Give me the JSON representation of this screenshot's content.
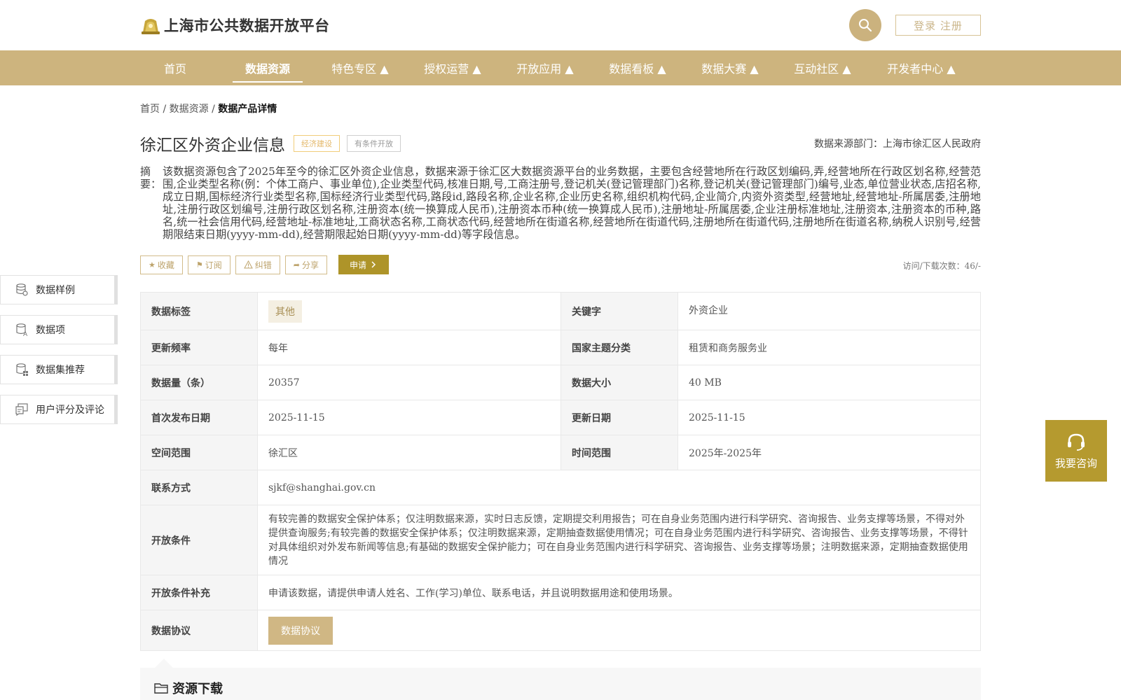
{
  "header": {
    "site_title": "上海市公共数据开放平台",
    "login_label": "登录 注册"
  },
  "nav": [
    {
      "label": "首页"
    },
    {
      "label": "数据资源"
    },
    {
      "label": "特色专区 ▲"
    },
    {
      "label": "授权运营 ▲"
    },
    {
      "label": "开放应用 ▲"
    },
    {
      "label": "数据看板 ▲"
    },
    {
      "label": "数据大赛 ▲"
    },
    {
      "label": "互动社区 ▲"
    },
    {
      "label": "开发者中心 ▲"
    }
  ],
  "breadcrumb": {
    "home": "首页",
    "sep": " / ",
    "resources": "数据资源",
    "current": "数据产品详情"
  },
  "dataset": {
    "title": "徐汇区外资企业信息",
    "tag_category": "经济建设",
    "tag_open": "有条件开放",
    "source_dept": "数据来源部门：上海市徐汇区人民政府",
    "abstract_label": "摘要：",
    "abstract": "该数据资源包含了2025年至今的徐汇区外资企业信息，数据来源于徐汇区大数据资源平台的业务数据，主要包含经营地所在行政区划编码,弄,经营地所在行政区划名称,经营范围,企业类型名称(例：个体工商户、事业单位),企业类型代码,核准日期,号,工商注册号,登记机关(登记管理部门)名称,登记机关(登记管理部门)编号,业态,单位营业状态,店招名称,成立日期,国标经济行业类型名称,国标经济行业类型代码,路段id,路段名称,企业名称,企业历史名称,组织机构代码,企业简介,内资外资类型,经营地址,经营地址-所属居委,注册地址,注册行政区划编号,注册行政区划名称,注册资本(统一换算成人民币),注册资本币种(统一换算成人民币),注册地址-所属居委,企业注册标准地址,注册资本,注册资本的币种,路名,统一社会信用代码,经营地址-标准地址,工商状态名称,工商状态代码,经营地所在街道名称,经营地所在街道代码,注册地所在街道代码,注册地所在街道名称,纳税人识别号,经营期限结束日期(yyyy-mm-dd),经营期限起始日期(yyyy-mm-dd)等字段信息。"
  },
  "actions": {
    "favorite": "收藏",
    "subscribe": "订阅",
    "report_error": "纠错",
    "share": "分享",
    "apply": "申请",
    "visit_count": "访问/下载次数：46/-"
  },
  "side_nav": [
    {
      "label": "数据样例",
      "icon": "database-icon"
    },
    {
      "label": "数据项",
      "icon": "data-items-icon"
    },
    {
      "label": "数据集推荐",
      "icon": "dataset-recommend-icon"
    },
    {
      "label": "用户评分及评论",
      "icon": "comment-icon"
    }
  ],
  "table": {
    "data_tag_label": "数据标签",
    "data_tag_value": "其他",
    "keyword_label": "关键字",
    "keyword_value": "外资企业",
    "update_freq_label": "更新频率",
    "update_freq_value": "每年",
    "theme_label": "国家主题分类",
    "theme_value": "租赁和商务服务业",
    "volume_label": "数据量（条）",
    "volume_value": "20357",
    "size_label": "数据大小",
    "size_value": "40 MB",
    "first_pub_label": "首次发布日期",
    "first_pub_value": "2025-11-15",
    "update_date_label": "更新日期",
    "update_date_value": "2025-11-15",
    "space_label": "空间范围",
    "space_value": "徐汇区",
    "time_label": "时间范围",
    "time_value": "2025年-2025年",
    "contact_label": "联系方式",
    "contact_value": "sjkf@shanghai.gov.cn",
    "open_cond_label": "开放条件",
    "open_cond_value": "有较完善的数据安全保护体系；仅注明数据来源，实时日志反馈，定期提交利用报告；可在自身业务范围内进行科学研究、咨询报告、业务支撑等场景，不得对外提供查询服务;有较完善的数据安全保护体系；仅注明数据来源，定期抽查数据使用情况；可在自身业务范围内进行科学研究、咨询报告、业务支撑等场景，不得针对具体组织对外发布新闻等信息;有基础的数据安全保护能力；可在自身业务范围内进行科学研究、咨询报告、业务支撑等场景；注明数据来源，定期抽查数据使用情况",
    "open_cond_extra_label": "开放条件补充",
    "open_cond_extra_value": "申请该数据，请提供申请人姓名、工作(学习)单位、联系电话，并且说明数据用途和使用场景。",
    "protocol_label": "数据协议",
    "protocol_button": "数据协议"
  },
  "download": {
    "title": "资源下载"
  },
  "consult": {
    "label": "我要咨询"
  },
  "colors": {
    "brand": "#cdb47e",
    "apply": "#ae9429",
    "consult": "#b59a2f"
  }
}
